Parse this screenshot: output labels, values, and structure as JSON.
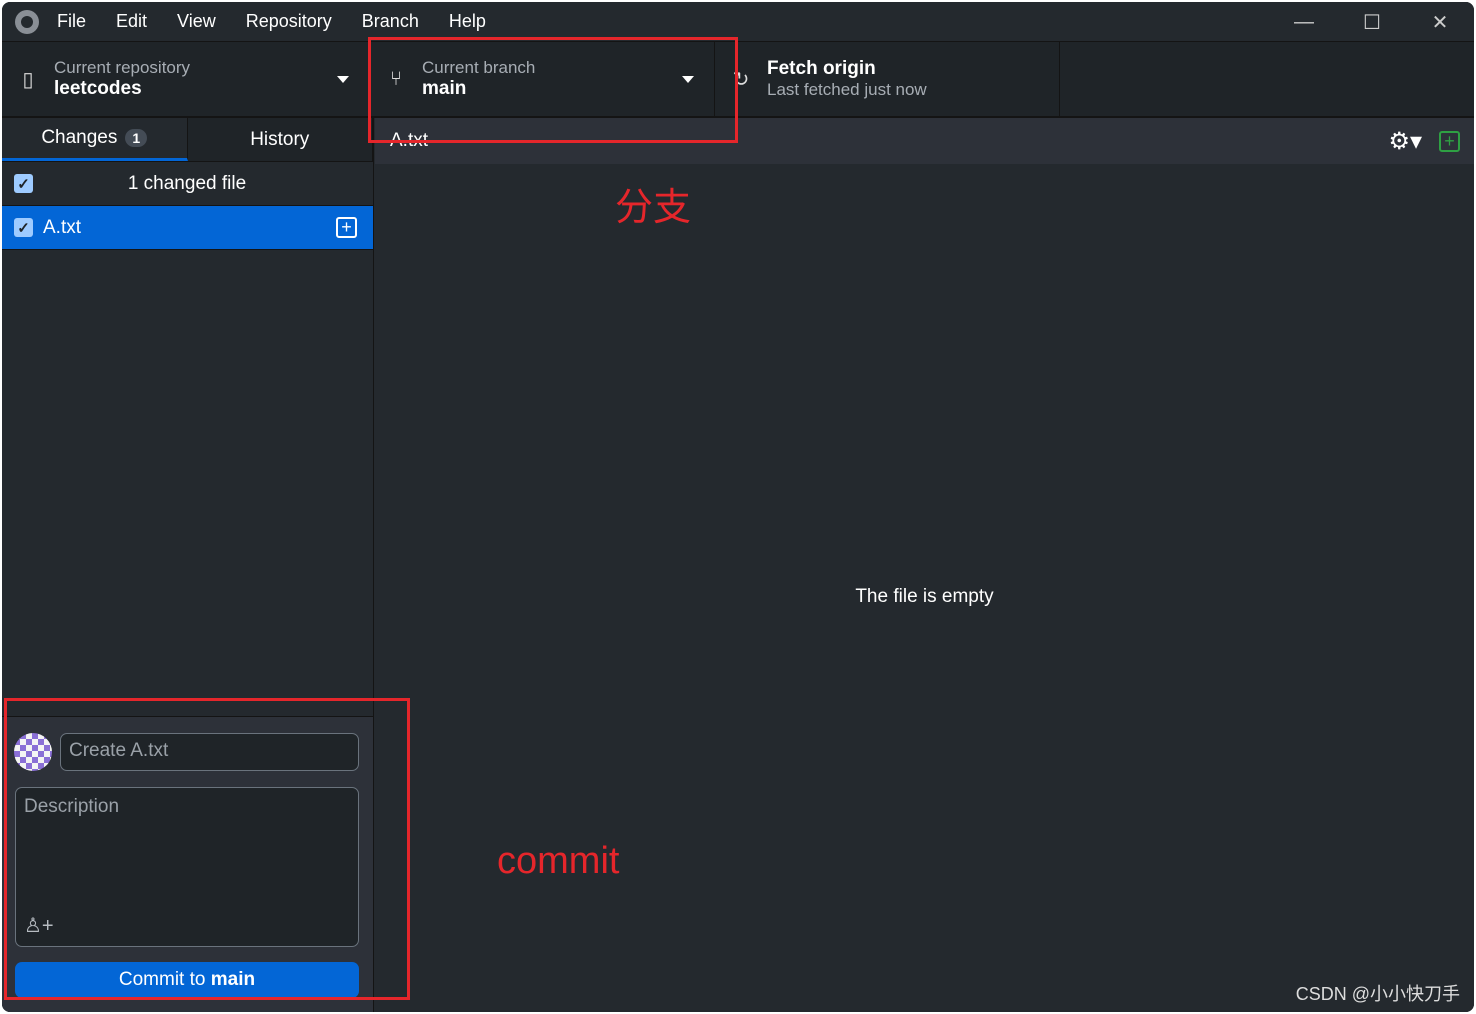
{
  "menu": [
    "File",
    "Edit",
    "View",
    "Repository",
    "Branch",
    "Help"
  ],
  "window_controls": {
    "minimize": "—",
    "maximize": "☐",
    "close": "✕"
  },
  "toolbar": {
    "repo": {
      "label": "Current repository",
      "value": "leetcodes"
    },
    "branch": {
      "label": "Current branch",
      "value": "main"
    },
    "fetch": {
      "label": "Fetch origin",
      "status": "Last fetched just now"
    }
  },
  "sidebar": {
    "tabs": [
      {
        "label": "Changes",
        "badge": "1"
      },
      {
        "label": "History"
      }
    ],
    "changed_header": "1 changed file",
    "files": [
      {
        "name": "A.txt",
        "status": "added",
        "checked": true
      }
    ],
    "commit": {
      "summary_value": "Create A.txt",
      "description_placeholder": "Description",
      "button_prefix": "Commit to ",
      "button_branch": "main"
    }
  },
  "main": {
    "file_title": "A.txt",
    "empty_message": "The file is empty"
  },
  "annotations": {
    "branch": "分支",
    "commit": "commit"
  },
  "watermark": "CSDN @小小快刀手",
  "colors": {
    "accent": "#0366d6",
    "annotation": "#e5262b",
    "added": "#2ea043"
  }
}
